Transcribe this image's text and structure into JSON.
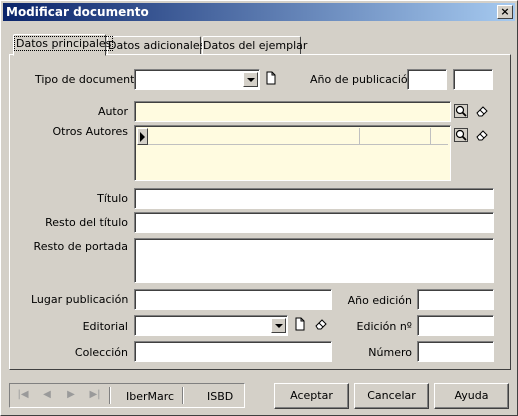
{
  "window": {
    "title": "Modificar documento",
    "close_glyph": "×"
  },
  "tabs": [
    {
      "label": "Datos principales",
      "active": true
    },
    {
      "label": "Datos adicionales",
      "active": false
    },
    {
      "label": "Datos del ejemplar",
      "active": false
    }
  ],
  "fields": {
    "tipo_documento": {
      "label": "Tipo de documento",
      "value": ""
    },
    "anio_publicacion": {
      "label": "Año de publicación",
      "value1": "",
      "value2": ""
    },
    "autor": {
      "label": "Autor",
      "value": ""
    },
    "otros_autores": {
      "label": "Otros Autores"
    },
    "titulo": {
      "label": "Título",
      "value": ""
    },
    "resto_titulo": {
      "label": "Resto del título",
      "value": ""
    },
    "resto_portada": {
      "label": "Resto de portada",
      "value": ""
    },
    "lugar_publicacion": {
      "label": "Lugar publicación",
      "value": ""
    },
    "anio_edicion": {
      "label": "Año edición",
      "value": ""
    },
    "editorial": {
      "label": "Editorial",
      "value": ""
    },
    "edicion_no": {
      "label": "Edición nº",
      "value": ""
    },
    "coleccion": {
      "label": "Colección",
      "value": ""
    },
    "numero": {
      "label": "Número",
      "value": ""
    }
  },
  "navigator": {
    "ibermarc": "IberMarc",
    "isbd": "ISBD"
  },
  "buttons": {
    "aceptar": "Aceptar",
    "cancelar": "Cancelar",
    "ayuda": "Ayuda"
  },
  "colors": {
    "title_start": "#0a246a",
    "title_end": "#a6caf0",
    "field_yellow": "#fffbe0",
    "face": "#d4d0c8"
  }
}
